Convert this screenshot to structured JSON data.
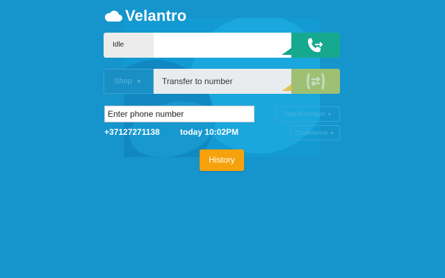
{
  "app": {
    "title": "Velantro"
  },
  "call_bar": {
    "status": "Idle",
    "number_value": "",
    "call_icon": "phone-arrow-icon"
  },
  "transfer_bar": {
    "select_label": "Shop",
    "placeholder": "Transfer to number",
    "transfer_icon": "transfer-arrows-icon"
  },
  "dial": {
    "placeholder": "Enter phone number",
    "search_contact_label": "Search contact",
    "conference_label": "Conference"
  },
  "last_call": {
    "number": "+37127271138",
    "time": "today 10:02PM"
  },
  "history_label": "History",
  "colors": {
    "background": "#1595cc",
    "call_green": "#16a98f",
    "transfer_green": "#9fbf73",
    "history_orange": "#f5a20d"
  }
}
